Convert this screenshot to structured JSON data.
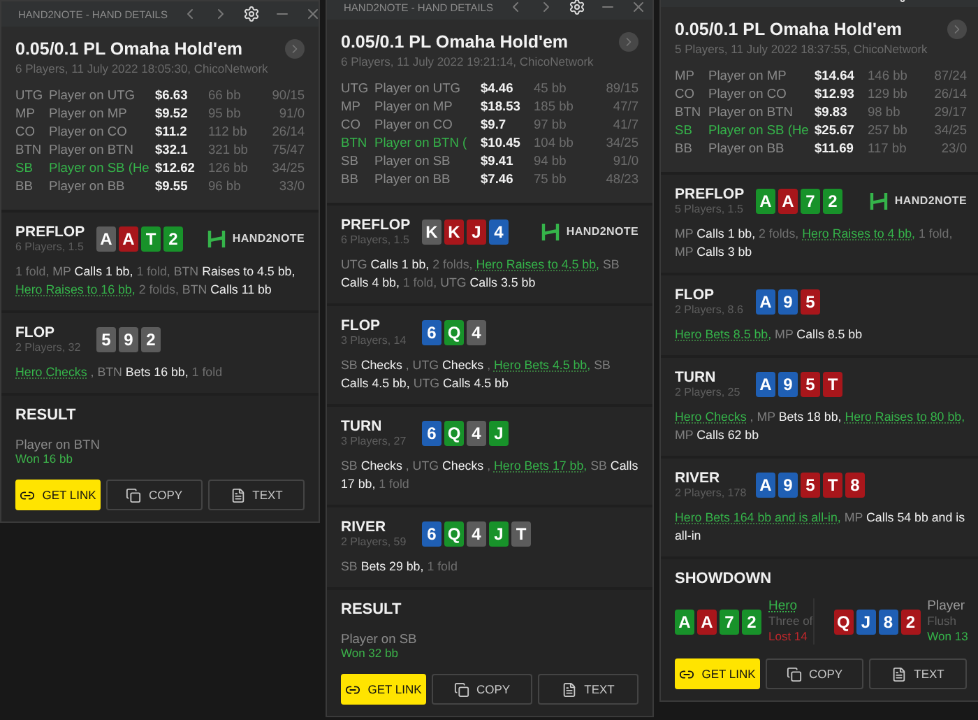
{
  "windows": [
    {
      "title": "HAND2NOTE - HAND DETAILS",
      "hand": {
        "title": "0.05/0.1 PL Omaha Hold'em",
        "subtitle": "6 Players, 11 July 2022 18:05:30, ChicoNetwork"
      },
      "players": [
        {
          "pos": "UTG",
          "name": "Player on UTG",
          "stack": "$6.63",
          "bb": "66 bb",
          "stats": "90/15",
          "hero": false
        },
        {
          "pos": "MP",
          "name": "Player on MP",
          "stack": "$9.52",
          "bb": "95 bb",
          "stats": "91/0",
          "hero": false
        },
        {
          "pos": "CO",
          "name": "Player on CO",
          "stack": "$11.2",
          "bb": "112 bb",
          "stats": "26/14",
          "hero": false
        },
        {
          "pos": "BTN",
          "name": "Player on BTN",
          "stack": "$32.1",
          "bb": "321 bb",
          "stats": "75/47",
          "hero": false
        },
        {
          "pos": "SB",
          "name": "Player on SB (He",
          "stack": "$12.62",
          "bb": "126 bb",
          "stats": "34/25",
          "hero": true
        },
        {
          "pos": "BB",
          "name": "Player on BB",
          "stack": "$9.55",
          "bb": "96 bb",
          "stats": "33/0",
          "hero": false
        }
      ],
      "streets": [
        {
          "name": "PREFLOP",
          "info": "6 Players, 1.5",
          "logo": "HAND2NOTE",
          "cards": [
            {
              "rank": "A",
              "color": "#5c5c5c"
            },
            {
              "rank": "A",
              "color": "#a8161b"
            },
            {
              "rank": "T",
              "color": "#18922a"
            },
            {
              "rank": "2",
              "color": "#18922a"
            }
          ],
          "actions": [
            {
              "kind": "note",
              "text": "1 fold,"
            },
            {
              "kind": "pos",
              "text": "MP"
            },
            {
              "kind": "act",
              "text": "Calls 1 bb,"
            },
            {
              "kind": "note",
              "text": "1 fold,"
            },
            {
              "kind": "pos",
              "text": "BTN"
            },
            {
              "kind": "act",
              "text": "Raises to 4.5 bb,"
            },
            {
              "kind": "hero",
              "text": "Hero Raises to 16 bb,"
            },
            {
              "kind": "note",
              "text": "2 folds,"
            },
            {
              "kind": "pos",
              "text": "BTN"
            },
            {
              "kind": "act",
              "text": "Calls 11 bb"
            }
          ]
        },
        {
          "name": "FLOP",
          "info": "2 Players, 32",
          "cards": [
            {
              "rank": "5",
              "color": "#5c5c5c"
            },
            {
              "rank": "9",
              "color": "#5c5c5c"
            },
            {
              "rank": "2",
              "color": "#5c5c5c"
            }
          ],
          "actions": [
            {
              "kind": "hero",
              "text": "Hero Checks"
            },
            {
              "kind": "pos",
              "text": ", BTN"
            },
            {
              "kind": "act",
              "text": "Bets 16 bb,"
            },
            {
              "kind": "note",
              "text": "1 fold"
            }
          ]
        }
      ],
      "final": {
        "kind": "result",
        "heading": "RESULT",
        "winner": "Player on BTN",
        "amount": "Won 16 bb"
      },
      "buttons": [
        {
          "kind": "link",
          "label": "GET LINK"
        },
        {
          "kind": "copy",
          "label": "COPY"
        },
        {
          "kind": "text",
          "label": "TEXT"
        }
      ]
    },
    {
      "title": "HAND2NOTE - HAND DETAILS",
      "hand": {
        "title": "0.05/0.1 PL Omaha Hold'em",
        "subtitle": "6 Players, 11 July 2022 19:21:14, ChicoNetwork"
      },
      "players": [
        {
          "pos": "UTG",
          "name": "Player on UTG",
          "stack": "$4.46",
          "bb": "45 bb",
          "stats": "89/15",
          "hero": false
        },
        {
          "pos": "MP",
          "name": "Player on MP",
          "stack": "$18.53",
          "bb": "185 bb",
          "stats": "47/7",
          "hero": false
        },
        {
          "pos": "CO",
          "name": "Player on CO",
          "stack": "$9.7",
          "bb": "97 bb",
          "stats": "41/7",
          "hero": false
        },
        {
          "pos": "BTN",
          "name": "Player on BTN (",
          "stack": "$10.45",
          "bb": "104 bb",
          "stats": "34/25",
          "hero": true
        },
        {
          "pos": "SB",
          "name": "Player on SB",
          "stack": "$9.41",
          "bb": "94 bb",
          "stats": "91/0",
          "hero": false
        },
        {
          "pos": "BB",
          "name": "Player on BB",
          "stack": "$7.46",
          "bb": "75 bb",
          "stats": "48/23",
          "hero": false
        }
      ],
      "streets": [
        {
          "name": "PREFLOP",
          "info": "6 Players, 1.5",
          "logo": "HAND2NOTE",
          "cards": [
            {
              "rank": "K",
              "color": "#5c5c5c"
            },
            {
              "rank": "K",
              "color": "#a8161b"
            },
            {
              "rank": "J",
              "color": "#a8161b"
            },
            {
              "rank": "4",
              "color": "#1f5fb4"
            }
          ],
          "actions": [
            {
              "kind": "pos",
              "text": "UTG"
            },
            {
              "kind": "act",
              "text": "Calls 1 bb,"
            },
            {
              "kind": "note",
              "text": "2 folds,"
            },
            {
              "kind": "hero",
              "text": "Hero Raises to 4.5 bb,"
            },
            {
              "kind": "pos",
              "text": "SB"
            },
            {
              "kind": "act",
              "text": "Calls 4 bb,"
            },
            {
              "kind": "note",
              "text": "1 fold,"
            },
            {
              "kind": "pos",
              "text": "UTG"
            },
            {
              "kind": "act",
              "text": "Calls 3.5 bb"
            }
          ]
        },
        {
          "name": "FLOP",
          "info": "3 Players, 14",
          "cards": [
            {
              "rank": "6",
              "color": "#1f5fb4"
            },
            {
              "rank": "Q",
              "color": "#18922a"
            },
            {
              "rank": "4",
              "color": "#5c5c5c"
            }
          ],
          "actions": [
            {
              "kind": "pos",
              "text": "SB"
            },
            {
              "kind": "act",
              "text": "Checks"
            },
            {
              "kind": "pos",
              "text": ", UTG"
            },
            {
              "kind": "act",
              "text": "Checks"
            },
            {
              "kind": "note",
              "text": ","
            },
            {
              "kind": "hero",
              "text": "Hero Bets 4.5 bb,"
            },
            {
              "kind": "pos",
              "text": "SB"
            },
            {
              "kind": "act",
              "text": "Calls 4.5 bb,"
            },
            {
              "kind": "pos",
              "text": "UTG"
            },
            {
              "kind": "act",
              "text": "Calls 4.5 bb"
            }
          ]
        },
        {
          "name": "TURN",
          "info": "3 Players, 27",
          "cards": [
            {
              "rank": "6",
              "color": "#1f5fb4"
            },
            {
              "rank": "Q",
              "color": "#18922a"
            },
            {
              "rank": "4",
              "color": "#5c5c5c"
            },
            {
              "rank": "J",
              "color": "#18922a"
            }
          ],
          "actions": [
            {
              "kind": "pos",
              "text": "SB"
            },
            {
              "kind": "act",
              "text": "Checks"
            },
            {
              "kind": "pos",
              "text": ", UTG"
            },
            {
              "kind": "act",
              "text": "Checks"
            },
            {
              "kind": "note",
              "text": ","
            },
            {
              "kind": "hero",
              "text": "Hero Bets 17 bb,"
            },
            {
              "kind": "pos",
              "text": "SB"
            },
            {
              "kind": "act",
              "text": "Calls 17 bb,"
            },
            {
              "kind": "note",
              "text": "1 fold"
            }
          ]
        },
        {
          "name": "RIVER",
          "info": "2 Players, 59",
          "cards": [
            {
              "rank": "6",
              "color": "#1f5fb4"
            },
            {
              "rank": "Q",
              "color": "#18922a"
            },
            {
              "rank": "4",
              "color": "#5c5c5c"
            },
            {
              "rank": "J",
              "color": "#18922a"
            },
            {
              "rank": "T",
              "color": "#5c5c5c"
            }
          ],
          "actions": [
            {
              "kind": "pos",
              "text": "SB"
            },
            {
              "kind": "act",
              "text": "Bets 29 bb,"
            },
            {
              "kind": "note",
              "text": "1 fold"
            }
          ]
        }
      ],
      "final": {
        "kind": "result",
        "heading": "RESULT",
        "winner": "Player on SB",
        "amount": "Won 32 bb"
      },
      "buttons": [
        {
          "kind": "link",
          "label": "GET LINK"
        },
        {
          "kind": "copy",
          "label": "COPY"
        },
        {
          "kind": "text",
          "label": "TEXT"
        }
      ]
    },
    {
      "hand": {
        "title": "0.05/0.1 PL Omaha Hold'em",
        "subtitle": "5 Players, 11 July 2022 18:37:55, ChicoNetwork"
      },
      "players": [
        {
          "pos": "MP",
          "name": "Player on MP",
          "stack": "$14.64",
          "bb": "146 bb",
          "stats": "87/24",
          "hero": false
        },
        {
          "pos": "CO",
          "name": "Player on CO",
          "stack": "$12.93",
          "bb": "129 bb",
          "stats": "26/14",
          "hero": false
        },
        {
          "pos": "BTN",
          "name": "Player on BTN",
          "stack": "$9.83",
          "bb": "98 bb",
          "stats": "29/17",
          "hero": false
        },
        {
          "pos": "SB",
          "name": "Player on SB (He",
          "stack": "$25.67",
          "bb": "257 bb",
          "stats": "34/25",
          "hero": true
        },
        {
          "pos": "BB",
          "name": "Player on BB",
          "stack": "$11.69",
          "bb": "117 bb",
          "stats": "23/0",
          "hero": false
        }
      ],
      "streets": [
        {
          "name": "PREFLOP",
          "info": "5 Players, 1.5",
          "logo": "HAND2NOTE",
          "cards": [
            {
              "rank": "A",
              "color": "#18922a"
            },
            {
              "rank": "A",
              "color": "#a8161b"
            },
            {
              "rank": "7",
              "color": "#18922a"
            },
            {
              "rank": "2",
              "color": "#18922a"
            }
          ],
          "actions": [
            {
              "kind": "pos",
              "text": "MP"
            },
            {
              "kind": "act",
              "text": "Calls 1 bb,"
            },
            {
              "kind": "note",
              "text": "2 folds,"
            },
            {
              "kind": "hero",
              "text": "Hero Raises to 4 bb,"
            },
            {
              "kind": "note",
              "text": "1 fold,"
            },
            {
              "kind": "pos",
              "text": "MP"
            },
            {
              "kind": "act",
              "text": "Calls 3 bb"
            }
          ]
        },
        {
          "name": "FLOP",
          "info": "2 Players, 8.6",
          "cards": [
            {
              "rank": "A",
              "color": "#1f5fb4"
            },
            {
              "rank": "9",
              "color": "#1f5fb4"
            },
            {
              "rank": "5",
              "color": "#a8161b"
            }
          ],
          "actions": [
            {
              "kind": "hero",
              "text": "Hero Bets 8.5 bb,"
            },
            {
              "kind": "pos",
              "text": "MP"
            },
            {
              "kind": "act",
              "text": "Calls 8.5 bb"
            }
          ]
        },
        {
          "name": "TURN",
          "info": "2 Players, 25",
          "cards": [
            {
              "rank": "A",
              "color": "#1f5fb4"
            },
            {
              "rank": "9",
              "color": "#1f5fb4"
            },
            {
              "rank": "5",
              "color": "#a8161b"
            },
            {
              "rank": "T",
              "color": "#a8161b"
            }
          ],
          "actions": [
            {
              "kind": "hero",
              "text": "Hero Checks"
            },
            {
              "kind": "pos",
              "text": ", MP"
            },
            {
              "kind": "act",
              "text": "Bets 18 bb,"
            },
            {
              "kind": "hero",
              "text": "Hero Raises to 80 bb,"
            },
            {
              "kind": "pos",
              "text": "MP"
            },
            {
              "kind": "act",
              "text": "Calls 62 bb"
            }
          ]
        },
        {
          "name": "RIVER",
          "info": "2 Players, 178",
          "cards": [
            {
              "rank": "A",
              "color": "#1f5fb4"
            },
            {
              "rank": "9",
              "color": "#1f5fb4"
            },
            {
              "rank": "5",
              "color": "#a8161b"
            },
            {
              "rank": "T",
              "color": "#a8161b"
            },
            {
              "rank": "8",
              "color": "#a8161b"
            }
          ],
          "actions": [
            {
              "kind": "hero",
              "text": "Hero Bets 164 bb and is all-in,"
            },
            {
              "kind": "pos",
              "text": "MP"
            },
            {
              "kind": "act",
              "text": "Calls 54 bb and is all-in"
            }
          ]
        }
      ],
      "final": {
        "kind": "showdown",
        "heading": "SHOWDOWN",
        "hands": [
          {
            "name": "Hero",
            "hero": true,
            "combo": "Three of",
            "outcome": "Lost 14",
            "won": false,
            "cards": [
              {
                "rank": "A",
                "color": "#18922a"
              },
              {
                "rank": "A",
                "color": "#a8161b"
              },
              {
                "rank": "7",
                "color": "#18922a"
              },
              {
                "rank": "2",
                "color": "#18922a"
              }
            ]
          },
          {
            "name": "Player",
            "hero": false,
            "combo": "Flush",
            "outcome": "Won 13",
            "won": true,
            "cards": [
              {
                "rank": "Q",
                "color": "#a8161b"
              },
              {
                "rank": "J",
                "color": "#1f5fb4"
              },
              {
                "rank": "8",
                "color": "#1f5fb4"
              },
              {
                "rank": "2",
                "color": "#a8161b"
              }
            ]
          }
        ]
      },
      "buttons": [
        {
          "kind": "link",
          "label": "GET LINK"
        },
        {
          "kind": "copy",
          "label": "COPY"
        },
        {
          "kind": "text",
          "label": "TEXT"
        }
      ]
    }
  ]
}
